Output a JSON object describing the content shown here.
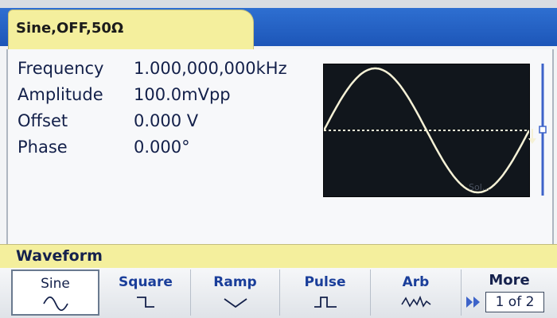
{
  "header": {
    "channel_status": "Sine,OFF,50Ω"
  },
  "parameters": [
    {
      "label": "Frequency",
      "value": "1.000,000,000kHz"
    },
    {
      "label": "Amplitude",
      "value": "100.0mVpp"
    },
    {
      "label": "Offset",
      "value": "0.000 V"
    },
    {
      "label": "Phase",
      "value": "0.000°"
    }
  ],
  "preview": {
    "type": "sine",
    "cycles": 1,
    "trace_color": "#f5f1d6",
    "background": "#11161c",
    "watermark": "Sol..."
  },
  "menu": {
    "title": "Waveform"
  },
  "softkeys": [
    {
      "label": "Sine",
      "icon": "sine-icon",
      "selected": true
    },
    {
      "label": "Square",
      "icon": "square-icon",
      "selected": false
    },
    {
      "label": "Ramp",
      "icon": "ramp-icon",
      "selected": false
    },
    {
      "label": "Pulse",
      "icon": "pulse-icon",
      "selected": false
    },
    {
      "label": "Arb",
      "icon": "arb-icon",
      "selected": false
    }
  ],
  "more": {
    "label": "More",
    "page": "1 of 2"
  },
  "colors": {
    "tab_yellow": "#f4ef9d",
    "header_blue": "#2e6fd1",
    "label_blue": "#1a3e9a"
  }
}
